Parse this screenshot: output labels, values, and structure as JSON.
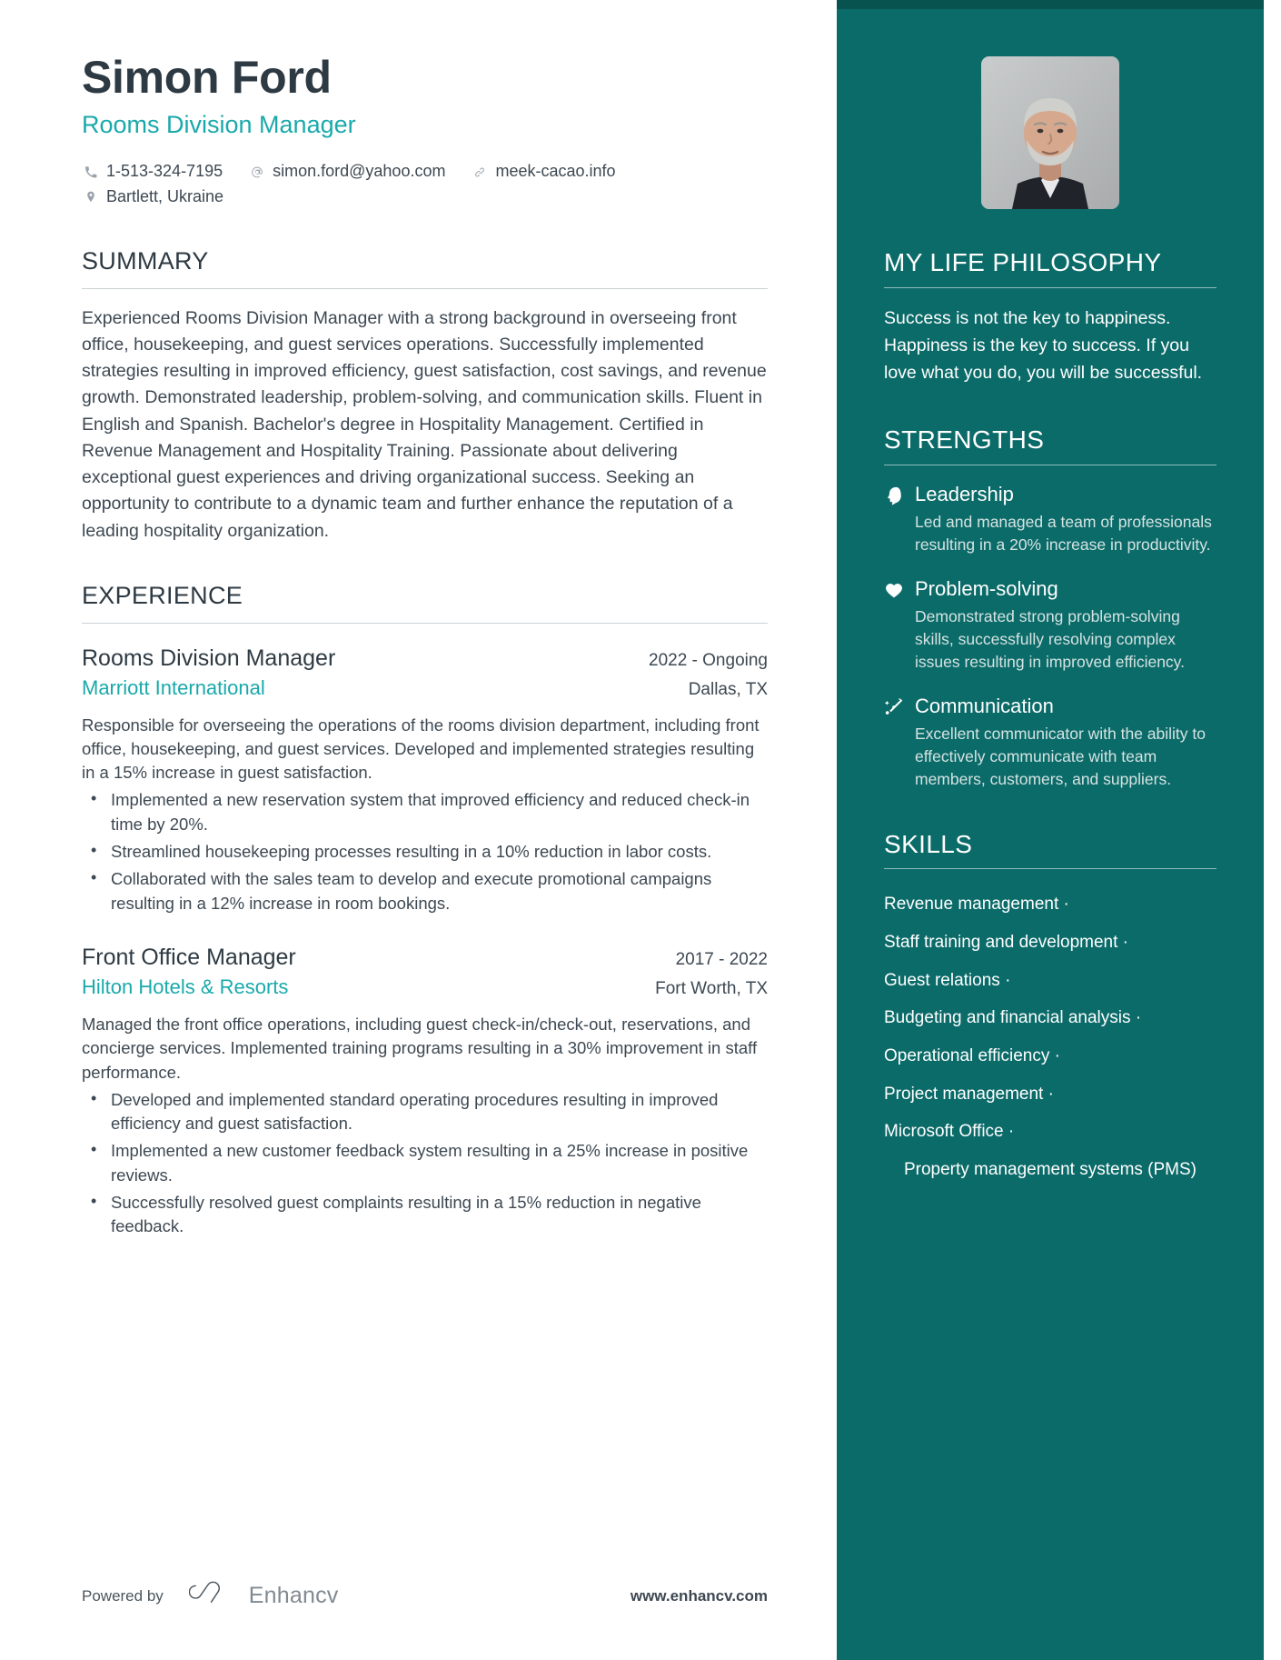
{
  "theme": {
    "sidebar_bg": "#0b6b69",
    "sidebar_top_strip": "#08524f",
    "accent_teal": "#1aa9ab",
    "heading_dark": "#2e3a43",
    "body_text": "#3d4852"
  },
  "header": {
    "name": "Simon Ford",
    "job_title": "Rooms Division Manager",
    "contacts": [
      {
        "icon": "phone-icon",
        "value": "1-513-324-7195"
      },
      {
        "icon": "email-icon",
        "value": "simon.ford@yahoo.com"
      },
      {
        "icon": "link-icon",
        "value": "meek-cacao.info"
      }
    ],
    "location": {
      "icon": "location-pin-icon",
      "value": "Bartlett, Ukraine"
    }
  },
  "summary": {
    "heading": "SUMMARY",
    "text": "Experienced Rooms Division Manager with a strong background in overseeing front office, housekeeping, and guest services operations. Successfully implemented strategies resulting in improved efficiency, guest satisfaction, cost savings, and revenue growth. Demonstrated leadership, problem-solving, and communication skills. Fluent in English and Spanish. Bachelor's degree in Hospitality Management. Certified in Revenue Management and Hospitality Training. Passionate about delivering exceptional guest experiences and driving organizational success. Seeking an opportunity to contribute to a dynamic team and further enhance the reputation of a leading hospitality organization."
  },
  "experience": {
    "heading": "EXPERIENCE",
    "entries": [
      {
        "role": "Rooms Division Manager",
        "dates": "2022 - Ongoing",
        "company": "Marriott International",
        "location": "Dallas, TX",
        "description": "Responsible for overseeing the operations of the rooms division department, including front office, housekeeping, and guest services. Developed and implemented strategies resulting in a 15% increase in guest satisfaction.",
        "bullets": [
          "Implemented a new reservation system that improved efficiency and reduced check-in time by 20%.",
          "Streamlined housekeeping processes resulting in a 10% reduction in labor costs.",
          "Collaborated with the sales team to develop and execute promotional campaigns resulting in a 12% increase in room bookings."
        ]
      },
      {
        "role": "Front Office Manager",
        "dates": "2017 - 2022",
        "company": "Hilton Hotels & Resorts",
        "location": "Fort Worth, TX",
        "description": "Managed the front office operations, including guest check-in/check-out, reservations, and concierge services. Implemented training programs resulting in a 30% improvement in staff performance.",
        "bullets": [
          "Developed and implemented standard operating procedures resulting in improved efficiency and guest satisfaction.",
          "Implemented a new customer feedback system resulting in a 25% increase in positive reviews.",
          "Successfully resolved guest complaints resulting in a 15% reduction in negative feedback."
        ]
      }
    ]
  },
  "philosophy": {
    "heading": "MY LIFE PHILOSOPHY",
    "text": "Success is not the key to happiness. Happiness is the key to success. If you love what you do, you will be successful."
  },
  "strengths": {
    "heading": "STRENGTHS",
    "items": [
      {
        "icon": "head-profile-icon",
        "title": "Leadership",
        "description": "Led and managed a team of professionals resulting in a 20% increase in productivity."
      },
      {
        "icon": "heart-icon",
        "title": "Problem-solving",
        "description": "Demonstrated strong problem-solving skills, successfully resolving complex issues resulting in improved efficiency."
      },
      {
        "icon": "shooting-star-icon",
        "title": "Communication",
        "description": "Excellent communicator with the ability to effectively communicate with team members, customers, and suppliers."
      }
    ]
  },
  "skills": {
    "heading": "SKILLS",
    "items": [
      "Revenue management ·",
      "Staff training and development ·",
      "Guest relations ·",
      "Budgeting and financial analysis ·",
      "Operational efficiency ·",
      "Project management ·",
      "Microsoft Office ·",
      "Property management systems (PMS)"
    ]
  },
  "footer": {
    "powered_by": "Powered by",
    "brand": "Enhancv",
    "url": "www.enhancv.com"
  }
}
